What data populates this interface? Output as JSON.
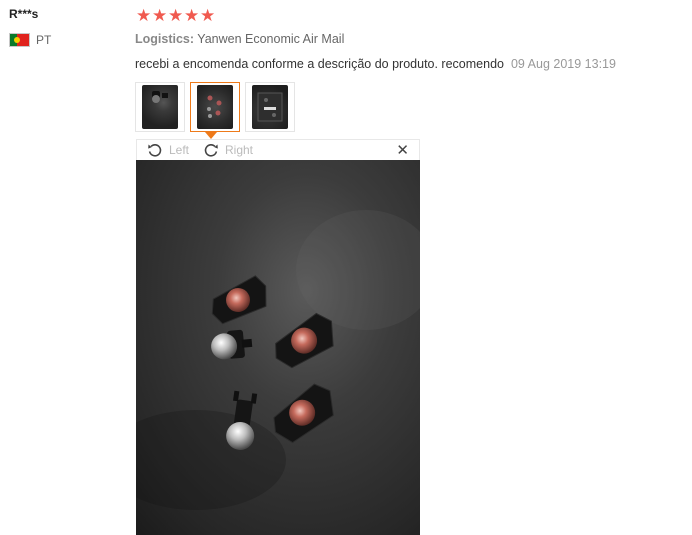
{
  "reviewer": {
    "name": "R***s",
    "country": "PT",
    "flag_icon": "portugal-flag-icon"
  },
  "rating": {
    "stars": 5,
    "max": 5,
    "color": "#f05a4f"
  },
  "logistics": {
    "label": "Logistics:",
    "value": "Yanwen Economic Air Mail"
  },
  "review": {
    "text": "recebi a encomenda conforme a descrição do produto. recomendo",
    "date": "09 Aug 2019 13:19"
  },
  "thumbnails": {
    "count": 3,
    "active_index": 1,
    "active_border_color": "#ee7a1a"
  },
  "viewer": {
    "rotate_left_label": "Left",
    "rotate_right_label": "Right",
    "close_icon": "close-icon",
    "rotate_left_icon": "rotate-left-icon",
    "rotate_right_icon": "rotate-right-icon"
  }
}
